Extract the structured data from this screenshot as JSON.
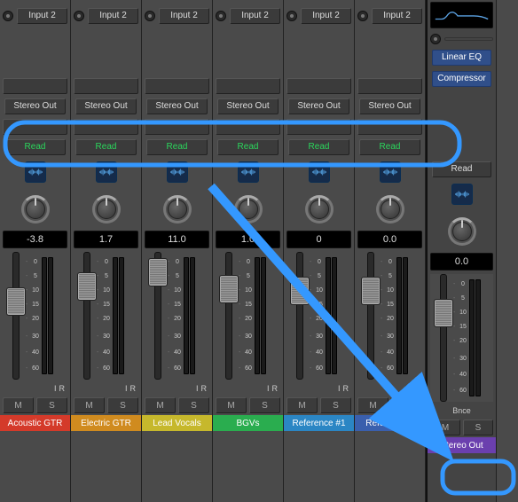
{
  "annotation_color": "#3498ff",
  "master": {
    "plugins": [
      "Linear EQ",
      "Compressor"
    ],
    "read_label": "Read",
    "bnce_label": "Bnce",
    "mute_label": "M",
    "solo_label": "S",
    "fader_value": "0.0",
    "name": "Stereo Out",
    "name_color": "#6b3fae"
  },
  "scale_labels": [
    "0",
    "5",
    "10",
    "15",
    "20",
    "30",
    "40",
    "60"
  ],
  "channels": [
    {
      "input_label": "Input 2",
      "output_label": "Stereo Out",
      "read_label": "Read",
      "fader_value": "-3.8",
      "fader_pos": 0.35,
      "pan_value": "0",
      "name": "Acoustic GTR",
      "name_color": "#d43a2a",
      "mute_label": "M",
      "solo_label": "S",
      "input_indicator": "I",
      "record_indicator": "R",
      "record_armed": false
    },
    {
      "input_label": "Input 2",
      "output_label": "Stereo Out",
      "read_label": "Read",
      "fader_value": "1.7",
      "fader_pos": 0.2,
      "pan_value": "0",
      "name": "Electric GTR",
      "name_color": "#d08b1f",
      "mute_label": "M",
      "solo_label": "S",
      "input_indicator": "I",
      "record_indicator": "R",
      "record_armed": false
    },
    {
      "input_label": "Input 2",
      "output_label": "Stereo Out",
      "read_label": "Read",
      "fader_value": "11.0",
      "fader_pos": 0.05,
      "pan_value": "0",
      "name": "Lead Vocals",
      "name_color": "#c6b82c",
      "mute_label": "M",
      "solo_label": "S",
      "input_indicator": "I",
      "record_indicator": "R",
      "record_armed": false
    },
    {
      "input_label": "Input 2",
      "output_label": "Stereo Out",
      "read_label": "Read",
      "fader_value": "1.0",
      "fader_pos": 0.22,
      "pan_value": "0",
      "name": "BGVs",
      "name_color": "#2aad4f",
      "mute_label": "M",
      "solo_label": "S",
      "input_indicator": "I",
      "record_indicator": "R",
      "record_armed": false
    },
    {
      "input_label": "Input 2",
      "output_label": "Stereo Out",
      "read_label": "Read",
      "fader_value": "0",
      "fader_pos": 0.24,
      "pan_value": "0",
      "name": "Reference #1",
      "name_color": "#2b86c4",
      "mute_label": "M",
      "solo_label": "S",
      "input_indicator": "I",
      "record_indicator": "R",
      "record_armed": false
    },
    {
      "input_label": "Input 2",
      "output_label": "Stereo Out",
      "read_label": "Read",
      "fader_value": "0.0",
      "fader_pos": 0.24,
      "pan_value": "0",
      "name": "Reference #",
      "name_color": "#3a5fad",
      "mute_label": "M",
      "solo_label": "S",
      "input_indicator": "I",
      "record_indicator": "R",
      "record_armed": true
    }
  ]
}
